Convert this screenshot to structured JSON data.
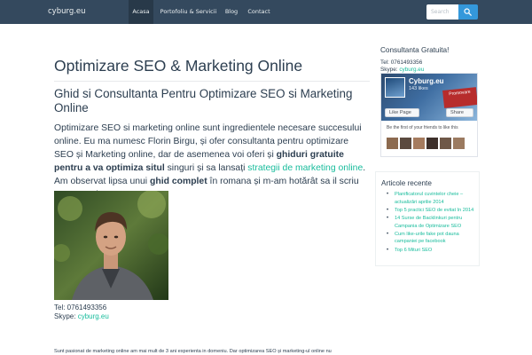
{
  "nav": {
    "brand": "cyburg.eu",
    "items": [
      {
        "label": "Acasa",
        "active": true
      },
      {
        "label": "Portofoliu & Servicii",
        "active": false
      },
      {
        "label": "Blog",
        "active": false
      },
      {
        "label": "Contact",
        "active": false
      }
    ],
    "search_placeholder": "Search",
    "search_icon": "search-icon"
  },
  "main": {
    "title": "Optimizare SEO & Marketing Online",
    "subtitle": "Ghid si Consultanta Pentru Optimizare SEO si Marketing Online",
    "intro": {
      "p1": "Optimizare SEO si marketing online sunt ingredientele necesare succesului online. Eu ma numesc Florin Birgu, și ofer consultanta pentru optimizare SEO și Marketing online, dar de asemenea voi oferi și ",
      "b1": "ghiduri gratuite pentru a va optimiza situl",
      "p2": " singuri și sa lansați ",
      "link": "strategii de marketing online",
      "p3": ". Am observat lipsa unui ",
      "b2": "ghid complet",
      "p4": " în romana și m-am hotărât sa il scriu pe acest site."
    },
    "contact": {
      "tel": "Tel: 0761493356",
      "skype_label": "Skype: ",
      "skype": "cyburg.eu"
    },
    "bottom_text": "Sunt pasionat de marketing online am mai mult de 3 ani experienta in domeniu. Dar optimizarea SEO și marketing-ul online nu"
  },
  "sidebar": {
    "title": "Consultanta Gratuita!",
    "tel": "Tel: 0761493356",
    "skype_label": "Skype: ",
    "skype": "cyburg.eu",
    "fb": {
      "page_name": "Cyburg.eu",
      "likes": "143 likes",
      "promo": "Promovare",
      "like_label": "Like Page",
      "share_label": "Share",
      "friends_text": "Be the first of your friends to like this"
    },
    "recent_title": "Articole recente",
    "recent": [
      "Planificatorul cuvintelor cheie – actualizări aprilie 2014",
      "Top 5 practici SEO de evitat în 2014",
      "14 Surse de Backlinkuri pentru Campania de Optimizare SEO",
      "Cum like-urile fake pot dauna campaniei pe facebook",
      "Top 6 Mituri SEO"
    ]
  },
  "colors": {
    "navbar": "#34495e",
    "nav_active": "#283949",
    "accent": "#18bc9c",
    "search_button": "#3498db",
    "text": "#2c3e50"
  }
}
